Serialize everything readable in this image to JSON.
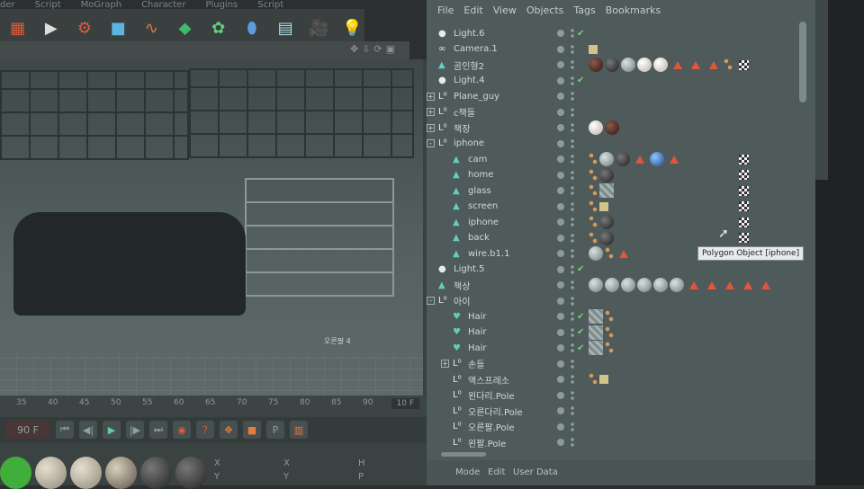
{
  "app_menu": [
    "der",
    "Script",
    "MoGraph",
    "Character",
    "Plugins",
    "Script"
  ],
  "toolbar": {
    "icons": [
      "render-region-icon",
      "render-view-icon",
      "render-settings-icon",
      "cube-icon",
      "spline-icon",
      "nurbs-icon",
      "array-icon",
      "deformer-icon",
      "floor-icon",
      "camera-icon",
      "light-icon"
    ]
  },
  "viewport": {
    "label": "오른팔 4"
  },
  "timeline": {
    "ticks": [
      "35",
      "40",
      "45",
      "50",
      "55",
      "60",
      "65",
      "70",
      "75",
      "80",
      "85",
      "90"
    ],
    "frame": "10 F",
    "current": "90 F"
  },
  "coords": {
    "labels": [
      "X",
      "X",
      "H",
      "Y",
      "Y",
      "P"
    ]
  },
  "object_manager": {
    "menu": [
      "File",
      "Edit",
      "View",
      "Objects",
      "Tags",
      "Bookmarks"
    ],
    "objects": [
      {
        "name": "Light.6",
        "icon": "light-icon",
        "level": 0,
        "check": true,
        "tags": []
      },
      {
        "name": "Camera.1",
        "icon": "camera-icon",
        "level": 0,
        "check": false,
        "tags": [
          "tg"
        ]
      },
      {
        "name": "곰인형2",
        "icon": "polygon-icon",
        "level": 0,
        "check": false,
        "tags": [
          "mr",
          "md",
          "mg",
          "ml",
          "ml",
          "tri",
          "tri",
          "tri",
          "chk",
          "uv",
          "tri"
        ]
      },
      {
        "name": "Light.4",
        "icon": "light-icon",
        "level": 0,
        "check": true,
        "tags": []
      },
      {
        "name": "Plane_guy",
        "icon": "null-icon",
        "level": 0,
        "expand": "+",
        "check": false,
        "tags": []
      },
      {
        "name": "c책들",
        "icon": "null-icon",
        "level": 0,
        "expand": "+",
        "check": false,
        "tags": []
      },
      {
        "name": "책장",
        "icon": "null-icon",
        "level": 0,
        "expand": "+",
        "check": false,
        "tags": [
          "ml",
          "mr"
        ]
      },
      {
        "name": "iphone",
        "icon": "null-icon",
        "level": 0,
        "expand": "-",
        "check": false,
        "tags": []
      },
      {
        "name": "cam",
        "icon": "polygon-icon",
        "level": 1,
        "check": false,
        "tags": [
          "uv",
          "chk",
          "mg",
          "md",
          "tri",
          "mb",
          "tri"
        ]
      },
      {
        "name": "home",
        "icon": "polygon-icon",
        "level": 1,
        "check": false,
        "tags": [
          "uv",
          "chk",
          "md"
        ]
      },
      {
        "name": "glass",
        "icon": "polygon-icon",
        "level": 1,
        "check": false,
        "tags": [
          "uv",
          "chk",
          "hatch"
        ]
      },
      {
        "name": "screen",
        "icon": "polygon-icon",
        "level": 1,
        "check": false,
        "tags": [
          "uv",
          "chk",
          "tg"
        ]
      },
      {
        "name": "iphone",
        "icon": "polygon-icon",
        "level": 1,
        "check": false,
        "tags": [
          "uv",
          "chk",
          "md"
        ]
      },
      {
        "name": "back",
        "icon": "polygon-icon",
        "level": 1,
        "check": false,
        "tags": [
          "uv",
          "chk",
          "md"
        ]
      },
      {
        "name": "wire.b1.1",
        "icon": "polygon-icon",
        "level": 1,
        "check": false,
        "tags": [
          "mg",
          "uv",
          "chk",
          "tri"
        ]
      },
      {
        "name": "Light.5",
        "icon": "light-icon",
        "level": 0,
        "check": true,
        "tags": []
      },
      {
        "name": "책상",
        "icon": "polygon-icon",
        "level": 0,
        "check": false,
        "tags": [
          "mg",
          "mg",
          "mg",
          "mg",
          "mg",
          "mg",
          "tri",
          "tri",
          "tri",
          "tri",
          "tri"
        ]
      },
      {
        "name": "아이",
        "icon": "null-icon",
        "level": 0,
        "expand": "-",
        "check": false,
        "tags": []
      },
      {
        "name": "Hair",
        "icon": "hair-icon",
        "level": 1,
        "check": true,
        "tags": [
          "hatch",
          "uv"
        ]
      },
      {
        "name": "Hair",
        "icon": "hair-icon",
        "level": 1,
        "check": true,
        "tags": [
          "hatch",
          "uv"
        ]
      },
      {
        "name": "Hair",
        "icon": "hair-icon",
        "level": 1,
        "check": true,
        "tags": [
          "hatch",
          "uv"
        ]
      },
      {
        "name": "손들",
        "icon": "null-icon",
        "level": 1,
        "expand": "+",
        "check": false,
        "tags": []
      },
      {
        "name": "액스프레소",
        "icon": "null-icon",
        "level": 1,
        "check": false,
        "tags": [
          "uv",
          "tg"
        ]
      },
      {
        "name": "왼다리.Pole",
        "icon": "null-icon",
        "level": 1,
        "check": false,
        "tags": []
      },
      {
        "name": "오른다리.Pole",
        "icon": "null-icon",
        "level": 1,
        "check": false,
        "tags": []
      },
      {
        "name": "오른팔.Pole",
        "icon": "null-icon",
        "level": 1,
        "check": false,
        "tags": []
      },
      {
        "name": "왼팔.Pole",
        "icon": "null-icon",
        "level": 1,
        "check": false,
        "tags": []
      }
    ],
    "tooltip": "Polygon Object [iphone]"
  },
  "attributes": {
    "menu": [
      "Mode",
      "Edit",
      "User Data"
    ]
  },
  "materials": [
    "#3fae3a",
    "#cfc6b3",
    "#cfc6b3",
    "#9a8f7c",
    "#4a4f4f",
    "#4a4f4f"
  ]
}
